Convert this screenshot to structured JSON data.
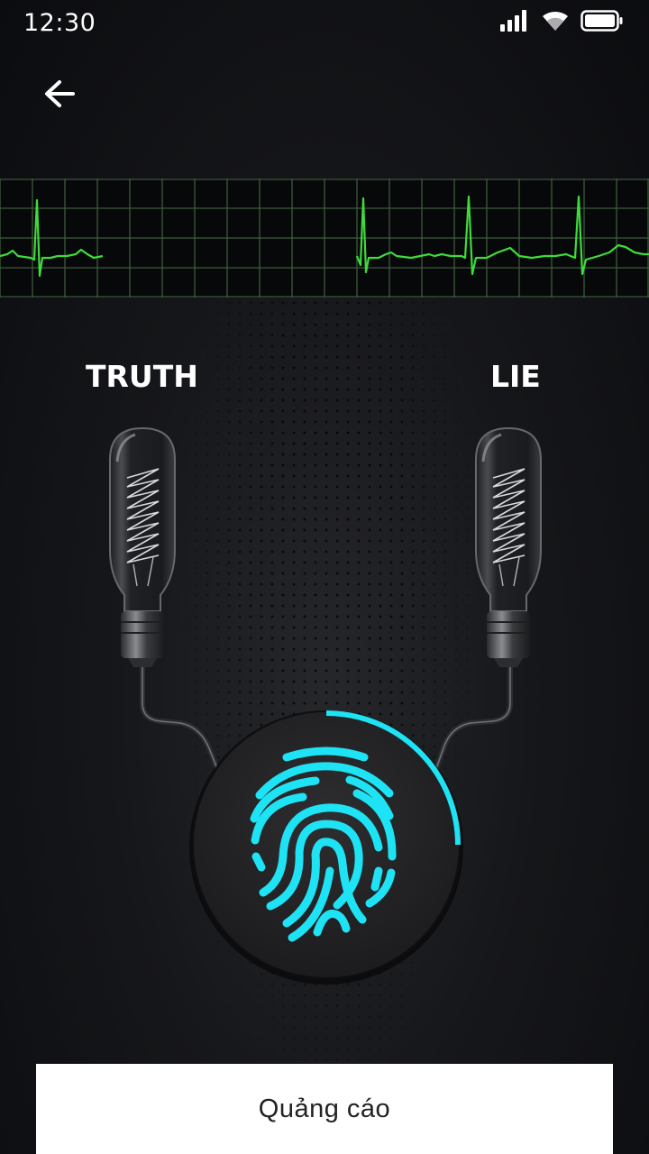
{
  "status_bar": {
    "time": "12:30",
    "icons": [
      "signal-icon",
      "wifi-icon",
      "battery-icon"
    ]
  },
  "nav": {
    "back_icon": "arrow-left-icon"
  },
  "labels": {
    "truth": "TRUTH",
    "lie": "LIE"
  },
  "scanner": {
    "icon": "fingerprint-icon",
    "progress": 0.25,
    "accent_color": "#1ee3f5"
  },
  "ecg": {
    "line_color": "#3ddc3a",
    "grid_color": "#3d5a3d"
  },
  "ad": {
    "text": "Quảng cáo"
  }
}
